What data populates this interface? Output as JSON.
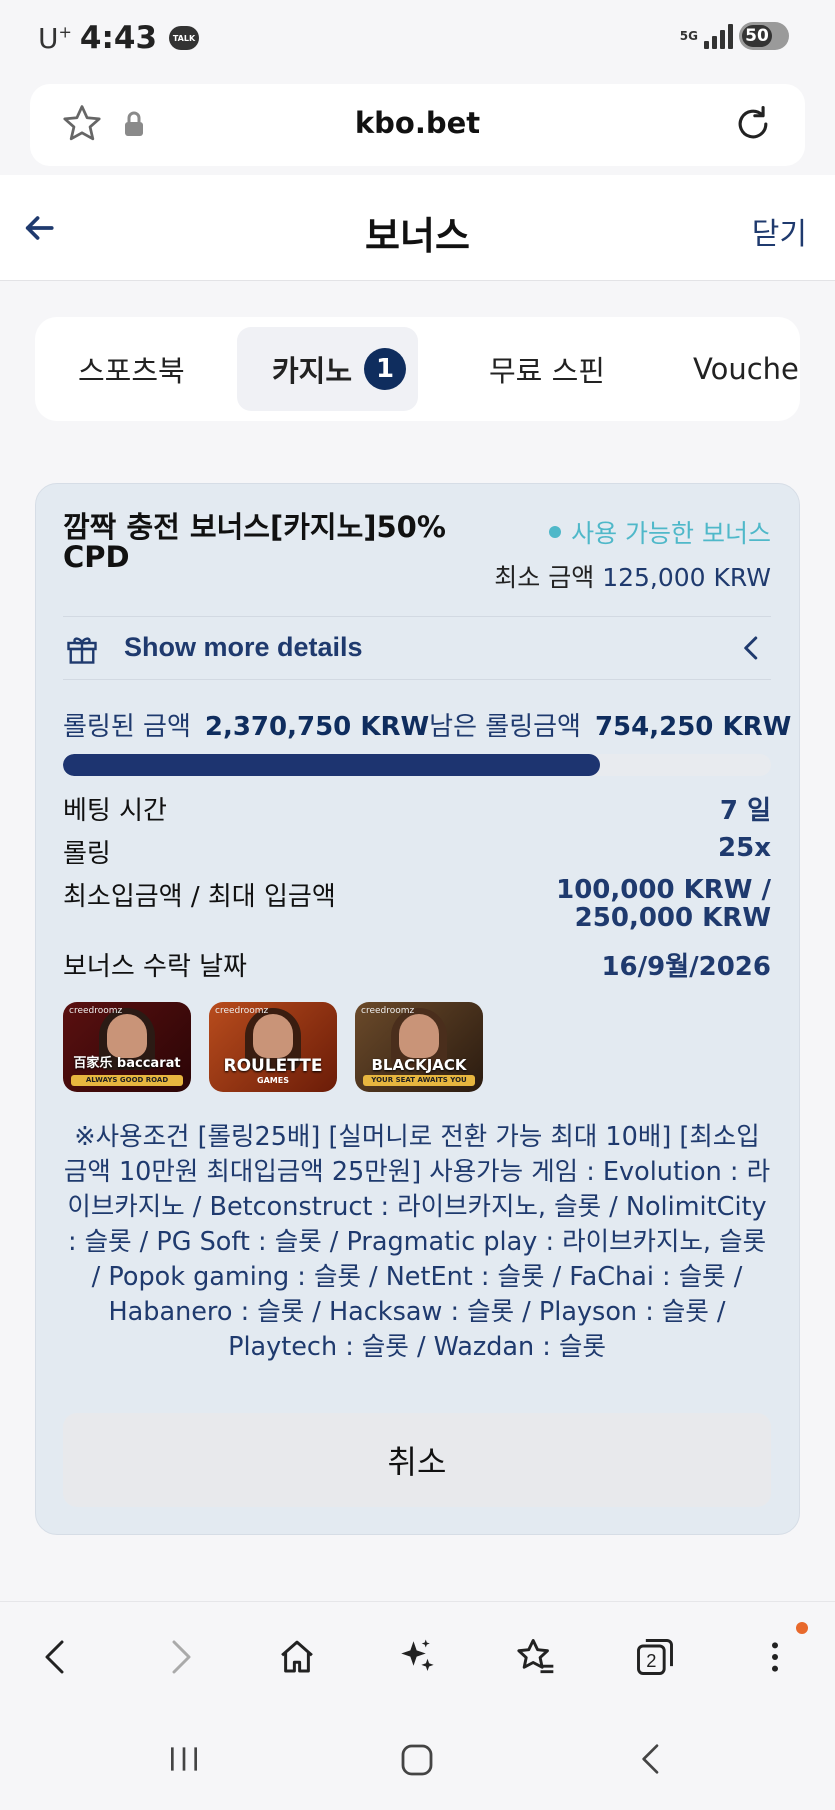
{
  "status_bar": {
    "carrier": "U",
    "carrier_sup": "+",
    "time": "4:43",
    "talk_badge": "TALK",
    "network": "5G",
    "battery": "50"
  },
  "browser": {
    "url": "kbo.bet"
  },
  "header": {
    "title": "보너스",
    "close_label": "닫기"
  },
  "tabs": [
    {
      "label": "스포츠북",
      "active": false
    },
    {
      "label": "카지노",
      "active": true,
      "badge": "1"
    },
    {
      "label": "무료 스핀",
      "active": false
    },
    {
      "label": "Vouche",
      "active": false
    }
  ],
  "bonus": {
    "title": "깜짝 충전 보너스[카지노]50% CPD",
    "status": "사용 가능한 보너스",
    "min_amount_label": "최소 금액",
    "min_amount_value": "125,000 KRW",
    "details_label": "Show more details",
    "rolled_label": "롤링된 금액",
    "rolled_value": "2,370,750 KRW",
    "remaining_label": "남은 롤링금액",
    "remaining_value": "754,250 KRW",
    "progress_percent": 75.9,
    "info": [
      {
        "key": "베팅 시간",
        "value": "7 일"
      },
      {
        "key": "롤링",
        "value": "25x"
      },
      {
        "key": "최소입금액 / 최대 입금액",
        "value": "100,000 KRW / 250,000 KRW"
      },
      {
        "key": "보너스 수락 날짜",
        "value": "16/9월/2026"
      }
    ],
    "games": [
      {
        "brand": "creedroomz",
        "name": "百家乐 baccarat",
        "tag": "ALWAYS GOOD ROAD"
      },
      {
        "brand": "creedroomz",
        "name": "ROULETTE",
        "tag": "GAMES"
      },
      {
        "brand": "creedroomz",
        "name": "BLACKJACK",
        "tag": "YOUR SEAT AWAITS YOU"
      }
    ],
    "terms": "※사용조건 [롤링25배] [실머니로 전환 가능 최대 10배] [최소입금액 10만원 최대입금액 25만원] 사용가능 게임 : Evolution : 라이브카지노 / Betconstruct : 라이브카지노, 슬롯 / NolimitCity : 슬롯 / PG Soft : 슬롯 / Pragmatic play : 라이브카지노, 슬롯 / Popok gaming : 슬롯 / NetEnt : 슬롯 / FaChai : 슬롯 / Habanero : 슬롯 / Hacksaw : 슬롯 / Playson : 슬롯 / Playtech : 슬롯 / Wazdan : 슬롯",
    "cancel_label": "취소"
  },
  "toolbar": {
    "tab_count": "2"
  },
  "colors": {
    "navy": "#1f3a6e",
    "badge": "#0f2d5e",
    "progress": "#1d3470",
    "teal": "#4fb8c9",
    "card_bg": "#e3eaf1",
    "notification": "#e8692c"
  }
}
